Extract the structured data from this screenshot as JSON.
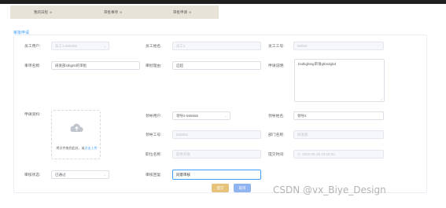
{
  "tabs": [
    {
      "label": "我的日程",
      "close": "⊗"
    },
    {
      "label": "审批事项",
      "close": "⊗"
    },
    {
      "label": "审批申请",
      "close": "⊗"
    }
  ],
  "section_title": "审批申请",
  "form": {
    "employee_user": {
      "label": "员工用户:",
      "value": "员工1-555555"
    },
    "employee_name": {
      "label": "员工姓名:",
      "value": "员工1"
    },
    "employee_no": {
      "label": "员工工号:",
      "value": "55555"
    },
    "matter_name": {
      "label": "事项名称:",
      "value": "研发部stbgtst的审批"
    },
    "approval_remark": {
      "label": "审批理由:",
      "value": "启超"
    },
    "apply_desc": {
      "label": "申请说明:",
      "value": "bsdkgbtsg审请gtbsdgbd"
    },
    "apply_material": {
      "label": "申请资料:"
    },
    "upload": {
      "text": "将文件拖到此处，或",
      "link": "点击上传"
    },
    "leader_user": {
      "label": "领导用户:",
      "value": "领导2-555555"
    },
    "leader_name": {
      "label": "领导姓名:",
      "value": "领导2"
    },
    "leader_no": {
      "label": "领导工号:",
      "value": "555555"
    },
    "dept_name": {
      "label": "部门名称:",
      "value": "研发部"
    },
    "position": {
      "label": "职位名称:",
      "value": "软件开发"
    },
    "submit_time": {
      "label": "提交时间:",
      "value": "2023-05-29 18:02:50"
    },
    "approval_status": {
      "label": "审核状态:",
      "value": "已通过"
    },
    "approval_reply": {
      "label": "审核回复:",
      "value": "同意审核"
    }
  },
  "buttons": {
    "submit": "提交",
    "cancel": "取消"
  },
  "colors": {
    "primary": "#409eff",
    "submit_btn": "#e6c27a",
    "cancel_btn": "#8fb4f0"
  },
  "watermark": "CSDN @vx_Biye_Design"
}
